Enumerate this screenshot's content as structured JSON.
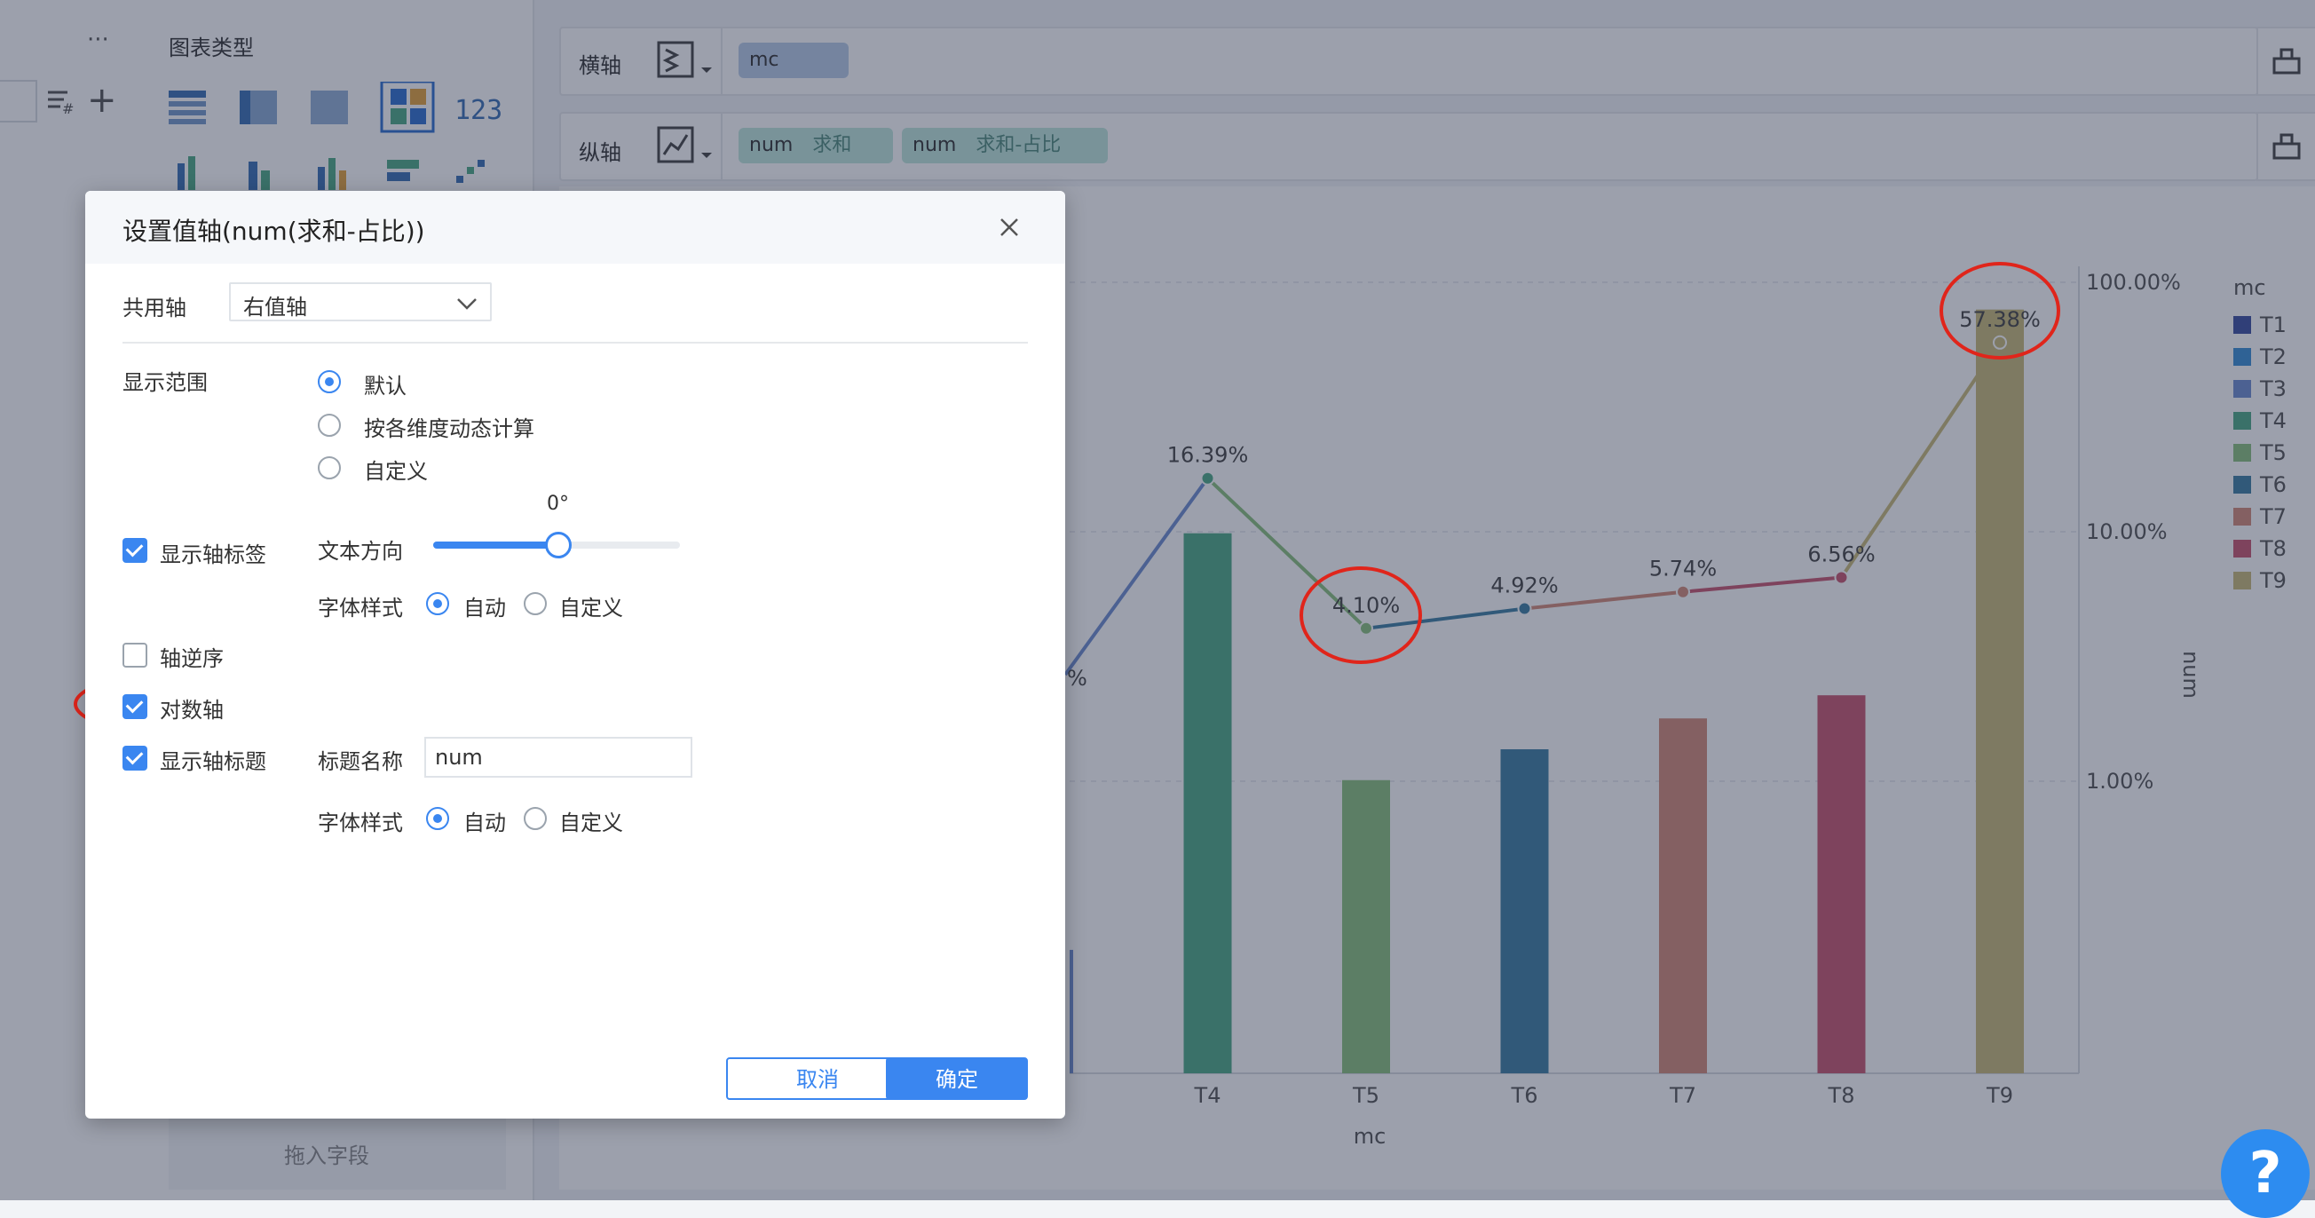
{
  "sidebar": {
    "more_label": "···",
    "add_label": "+"
  },
  "chart_types": {
    "title": "图表类型",
    "selected_numeric_icon": "123"
  },
  "shelves": {
    "x_axis": {
      "label": "横轴",
      "fields": [
        {
          "name": "mc"
        }
      ]
    },
    "y_axis": {
      "label": "纵轴",
      "fields": [
        {
          "name": "num",
          "agg": "求和"
        },
        {
          "name": "num",
          "agg": "求和-占比"
        }
      ]
    }
  },
  "drop_hint": "拖入字段",
  "dialog": {
    "title": "设置值轴(num(求和-占比))",
    "shared_axis": {
      "label": "共用轴",
      "value": "右值轴"
    },
    "display_range": {
      "label": "显示范围",
      "options": [
        "默认",
        "按各维度动态计算",
        "自定义"
      ],
      "selected": 0
    },
    "show_axis_labels": {
      "label": "显示轴标签",
      "checked": true
    },
    "text_direction": {
      "label": "文本方向",
      "value_label": "0°",
      "value": 0
    },
    "font_style_1": {
      "label": "字体样式",
      "options": [
        "自动",
        "自定义"
      ],
      "selected": 0
    },
    "reverse_axis": {
      "label": "轴逆序",
      "checked": false
    },
    "log_axis": {
      "label": "对数轴",
      "checked": true
    },
    "show_axis_title": {
      "label": "显示轴标题",
      "checked": true
    },
    "title_name": {
      "label": "标题名称",
      "value": "num"
    },
    "font_style_2": {
      "label": "字体样式",
      "options": [
        "自动",
        "自定义"
      ],
      "selected": 0
    },
    "cancel_label": "取消",
    "ok_label": "确定"
  },
  "help_label": "?",
  "colors": {
    "accent": "#3a86f0",
    "annotation": "#e0251b"
  },
  "chart_data": {
    "type": "bar",
    "xlabel": "mc",
    "ylabel_right": "num",
    "categories": [
      "T1",
      "T2",
      "T3",
      "T4",
      "T5",
      "T6",
      "T7",
      "T8",
      "T9"
    ],
    "right_axis_ticks": [
      "100.00%",
      "10.00%",
      "1.00%"
    ],
    "right_axis_scale": "log",
    "legend_title": "mc",
    "legend_position": "right",
    "visible_categories": [
      "T4",
      "T5",
      "T6",
      "T7",
      "T8",
      "T9"
    ],
    "series": [
      {
        "name": "num",
        "kind": "bar",
        "relative_heights": [
          null,
          null,
          0.16,
          0.7,
          0.38,
          0.42,
          0.46,
          0.49,
          0.99
        ]
      },
      {
        "name": "num",
        "kind": "line",
        "values": [
          null,
          null,
          null,
          16.39,
          4.1,
          4.92,
          5.74,
          6.56,
          57.38
        ],
        "labels": [
          "",
          "",
          "",
          "16.39%",
          "4.10%",
          "4.92%",
          "5.74%",
          "6.56%",
          "57.38%"
        ],
        "clipped_label": "%"
      }
    ],
    "colors": [
      "#3b4fa0",
      "#3a8fd6",
      "#6d8ccf",
      "#4daa86",
      "#8bc17f",
      "#3c7fa2",
      "#d48a78",
      "#c8566f",
      "#c9ba78"
    ]
  }
}
